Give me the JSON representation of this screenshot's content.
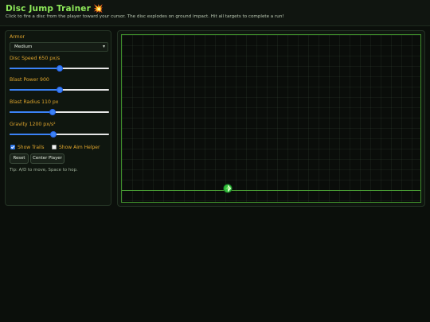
{
  "header": {
    "title": "Disc Jump Trainer",
    "title_icon": "collision-icon",
    "subtitle": "Click to fire a disc from the player toward your cursor. The disc explodes on ground impact. Hit all targets to complete a run!"
  },
  "controls": {
    "armor": {
      "label": "Armor",
      "selected": "Medium"
    },
    "disc_speed": {
      "label": "Disc Speed 650 px/s",
      "value": 650
    },
    "blast_power": {
      "label": "Blast Power 900",
      "value": 900
    },
    "blast_radius": {
      "label": "Blast Radius 110 px",
      "value": 110
    },
    "gravity": {
      "label": "Gravity 1200 px/s²",
      "value": 1200
    },
    "show_trails": {
      "label": "Show Trails",
      "checked": true
    },
    "show_aim_helper": {
      "label": "Show Aim Helper",
      "checked": false
    },
    "reset_label": "Reset",
    "center_player_label": "Center Player",
    "tip": "Tip: A/D to move, Space to hop."
  },
  "slider_levels": {
    "disc_speed": 0.5,
    "blast_power": 0.5,
    "blast_radius": 0.43,
    "gravity": 0.44
  },
  "colors": {
    "accent_green": "#8eea5a",
    "label_orange": "#e0a62d",
    "slider_blue": "#3b82f6",
    "ground_green": "#4ea838"
  }
}
